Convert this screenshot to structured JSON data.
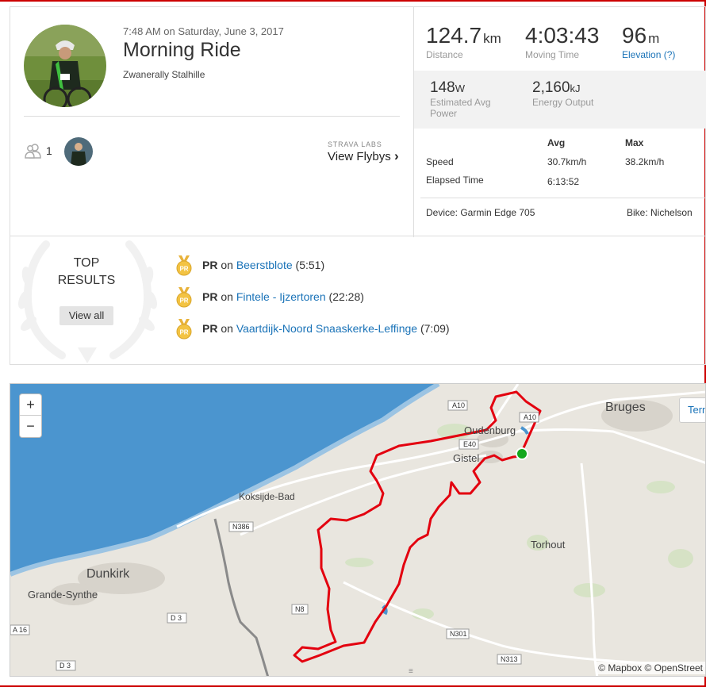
{
  "activity": {
    "datetime": "7:48 AM on Saturday, June 3, 2017",
    "title": "Morning Ride",
    "athlete": "Zwanerally Stalhille",
    "athlete_count": "1"
  },
  "flybys": {
    "labs": "STRAVA LABS",
    "label": "View Flybys",
    "chevron": "›"
  },
  "stats": {
    "distance": {
      "value": "124.7",
      "unit": "km",
      "label": "Distance"
    },
    "moving_time": {
      "value": "4:03:43",
      "label": "Moving Time"
    },
    "elevation": {
      "value": "96",
      "unit": "m",
      "label": "Elevation (?)"
    },
    "power": {
      "value": "148",
      "unit": "W",
      "label": "Estimated Avg Power"
    },
    "energy": {
      "value": "2,160",
      "unit": "kJ",
      "label": "Energy Output"
    }
  },
  "table": {
    "col_avg": "Avg",
    "col_max": "Max",
    "speed_label": "Speed",
    "speed_avg": "30.7km/h",
    "speed_max": "38.2km/h",
    "elapsed_label": "Elapsed Time",
    "elapsed_avg": "6:13:52"
  },
  "device": "Device: Garmin Edge 705",
  "bike": "Bike: Nichelson",
  "results": {
    "heading": "TOP RESULTS",
    "view_all": "View all",
    "medal_text": "PR",
    "items": [
      {
        "badge": "PR",
        "on": "on",
        "segment": "Beerstblote",
        "time": "(5:51)"
      },
      {
        "badge": "PR",
        "on": "on",
        "segment": "Fintele - Ijzertoren",
        "time": "(22:28)"
      },
      {
        "badge": "PR",
        "on": "on",
        "segment": "Vaartdijk-Noord Snaaskerke-Leffinge",
        "time": "(7:09)"
      }
    ]
  },
  "map": {
    "zoom_in": "+",
    "zoom_out": "−",
    "terms": "Tern",
    "attribution": "© Mapbox © OpenStreet",
    "grip": "≡",
    "places": {
      "bruges": "Bruges",
      "oudenburg": "Oudenburg",
      "gistel": "Gistel",
      "koksijde": "Koksijde-Bad",
      "torhout": "Torhout",
      "dunkirk": "Dunkirk",
      "grande_synthe": "Grande-Synthe"
    },
    "roads": {
      "a10_a": "A10",
      "a10_b": "A10",
      "e40": "E40",
      "n386": "N386",
      "n8": "N8",
      "d3_a": "D 3",
      "a16": "A 16",
      "d3_b": "D 3",
      "n301": "N301",
      "n313": "N313"
    },
    "colors": {
      "sea": "#4b95cf",
      "land": "#e9e6df",
      "route": "#e3000f",
      "start": "#14a81e"
    }
  }
}
